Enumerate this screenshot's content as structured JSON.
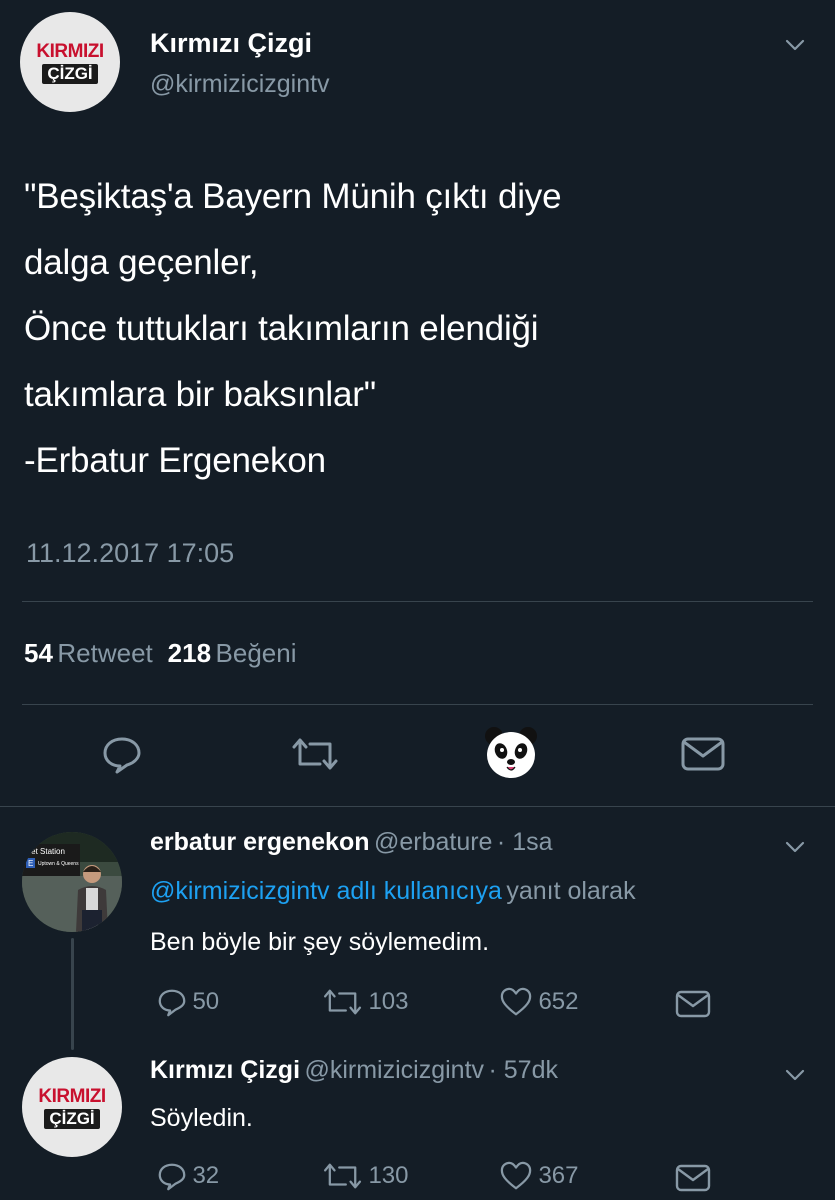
{
  "main_tweet": {
    "avatar_logo_top": "KIRMIZI",
    "avatar_logo_bottom": "ÇİZGİ",
    "name": "Kırmızı Çizgi",
    "handle": "@kirmizicizgintv",
    "text_lines": [
      "\"Beşiktaş'a Bayern Münih çıktı diye",
      "dalga geçenler,",
      "Önce tuttukları takımların elendiği",
      "takımlara bir baksınlar\"",
      "-Erbatur Ergenekon"
    ],
    "timestamp": "11.12.2017 17:05",
    "retweet_count": "54",
    "retweet_label": "Retweet",
    "like_count": "218",
    "like_label": "Beğeni",
    "actions": [
      "reply-icon",
      "retweet-icon",
      "panda-sticker",
      "dm-icon"
    ]
  },
  "replies": [
    {
      "avatar_sign_line1": "reet Station",
      "avatar_sign_letter": "E",
      "avatar_sign_line2": "Uptown & Queens",
      "name": "erbatur ergenekon",
      "handle": "@erbature",
      "time": "· 1sa",
      "reply_to_link": "@kirmizicizgintv adlı kullanıcıya",
      "reply_to_suffix": "yanıt olarak",
      "text": "Ben böyle bir şey söylemedim.",
      "reply_count": "50",
      "retweet_count": "103",
      "like_count": "652"
    },
    {
      "avatar_logo_top": "KIRMIZI",
      "avatar_logo_bottom": "ÇİZGİ",
      "name": "Kırmızı Çizgi",
      "handle": "@kirmizicizgintv",
      "time": "· 57dk",
      "text": "Söyledin.",
      "reply_count": "32",
      "retweet_count": "130",
      "like_count": "367"
    }
  ],
  "colors": {
    "background": "#141d26",
    "muted_text": "#8899a6",
    "link": "#1da1f2",
    "divider": "#38444d",
    "logo_red": "#c8102e"
  }
}
